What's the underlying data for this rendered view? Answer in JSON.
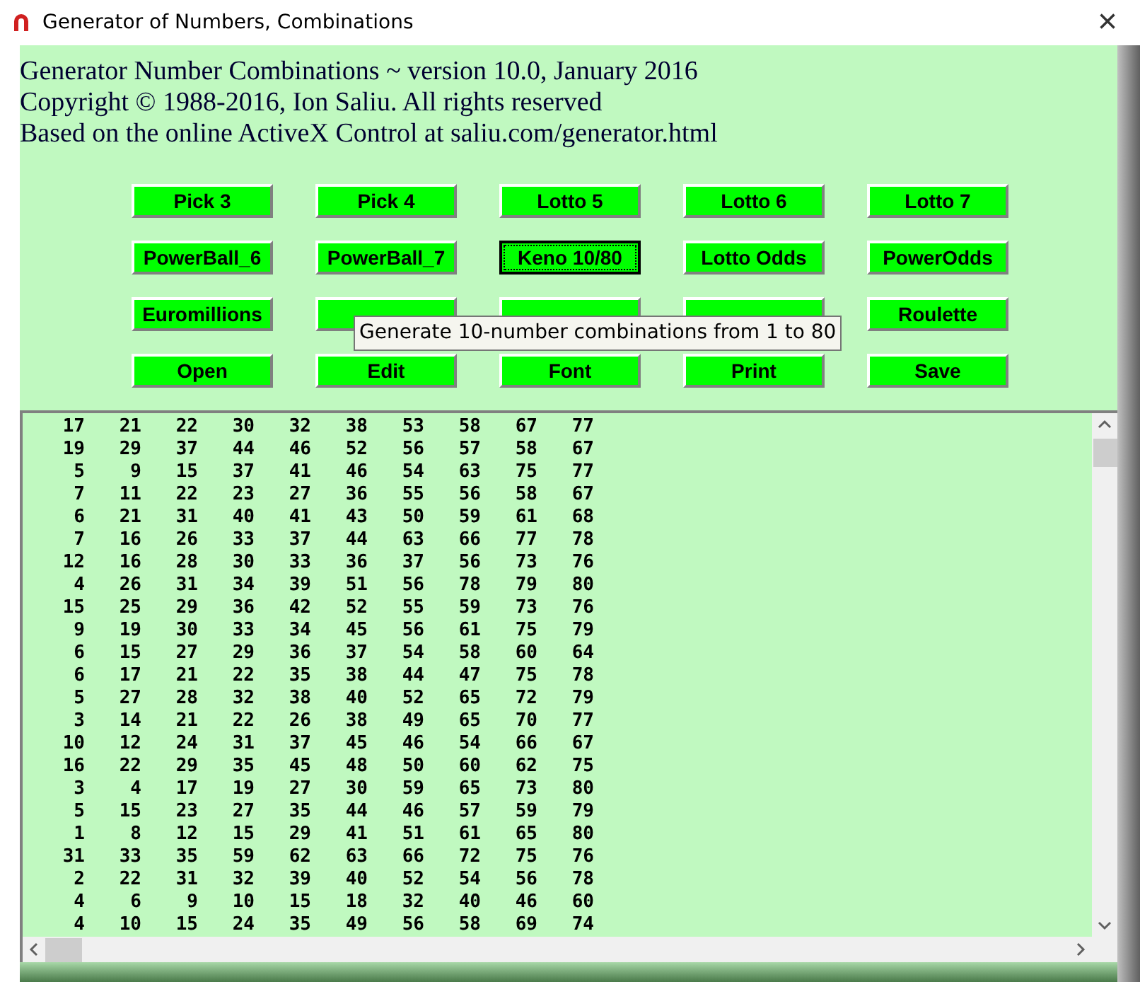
{
  "window": {
    "title": "Generator of Numbers, Combinations",
    "close": "×"
  },
  "header": [
    "Generator Number Combinations ~ version 10.0, January 2016",
    "Copyright © 1988-2016, Ion Saliu. All rights reserved",
    "Based on the online ActiveX Control at saliu.com/generator.html"
  ],
  "buttons": [
    {
      "label": "Pick 3",
      "focused": false
    },
    {
      "label": "Pick 4",
      "focused": false
    },
    {
      "label": "Lotto 5",
      "focused": false
    },
    {
      "label": "Lotto 6",
      "focused": false
    },
    {
      "label": "Lotto 7",
      "focused": false
    },
    {
      "label": "PowerBall_6",
      "focused": false
    },
    {
      "label": "PowerBall_7",
      "focused": false
    },
    {
      "label": "Keno 10/80",
      "focused": true
    },
    {
      "label": "Lotto Odds",
      "focused": false
    },
    {
      "label": "PowerOdds",
      "focused": false
    },
    {
      "label": "Euromillions",
      "focused": false
    },
    {
      "focused": false
    },
    {
      "focused": false
    },
    {
      "focused": false
    },
    {
      "label": "Roulette",
      "focused": false
    },
    {
      "label": "Open",
      "focused": false
    },
    {
      "label": "Edit",
      "focused": false
    },
    {
      "label": "Font",
      "focused": false
    },
    {
      "label": "Print",
      "focused": false
    },
    {
      "label": "Save",
      "focused": false
    }
  ],
  "tooltip": "Generate 10-number combinations from 1 to 80",
  "rows": [
    [
      "17",
      "21",
      "22",
      "30",
      "32",
      "38",
      "53",
      "58",
      "67",
      "77"
    ],
    [
      "19",
      "29",
      "37",
      "44",
      "46",
      "52",
      "56",
      "57",
      "58",
      "67"
    ],
    [
      "5",
      "9",
      "15",
      "37",
      "41",
      "46",
      "54",
      "63",
      "75",
      "77"
    ],
    [
      "7",
      "11",
      "22",
      "23",
      "27",
      "36",
      "55",
      "56",
      "58",
      "67"
    ],
    [
      "6",
      "21",
      "31",
      "40",
      "41",
      "43",
      "50",
      "59",
      "61",
      "68"
    ],
    [
      "7",
      "16",
      "26",
      "33",
      "37",
      "44",
      "63",
      "66",
      "77",
      "78"
    ],
    [
      "12",
      "16",
      "28",
      "30",
      "33",
      "36",
      "37",
      "56",
      "73",
      "76"
    ],
    [
      "4",
      "26",
      "31",
      "34",
      "39",
      "51",
      "56",
      "78",
      "79",
      "80"
    ],
    [
      "15",
      "25",
      "29",
      "36",
      "42",
      "52",
      "55",
      "59",
      "73",
      "76"
    ],
    [
      "9",
      "19",
      "30",
      "33",
      "34",
      "45",
      "56",
      "61",
      "75",
      "79"
    ],
    [
      "6",
      "15",
      "27",
      "29",
      "36",
      "37",
      "54",
      "58",
      "60",
      "64"
    ],
    [
      "6",
      "17",
      "21",
      "22",
      "35",
      "38",
      "44",
      "47",
      "75",
      "78"
    ],
    [
      "5",
      "27",
      "28",
      "32",
      "38",
      "40",
      "52",
      "65",
      "72",
      "79"
    ],
    [
      "3",
      "14",
      "21",
      "22",
      "26",
      "38",
      "49",
      "65",
      "70",
      "77"
    ],
    [
      "10",
      "12",
      "24",
      "31",
      "37",
      "45",
      "46",
      "54",
      "66",
      "67"
    ],
    [
      "16",
      "22",
      "29",
      "35",
      "45",
      "48",
      "50",
      "60",
      "62",
      "75"
    ],
    [
      "3",
      "4",
      "17",
      "19",
      "27",
      "30",
      "59",
      "65",
      "73",
      "80"
    ],
    [
      "5",
      "15",
      "23",
      "27",
      "35",
      "44",
      "46",
      "57",
      "59",
      "79"
    ],
    [
      "1",
      "8",
      "12",
      "15",
      "29",
      "41",
      "51",
      "61",
      "65",
      "80"
    ],
    [
      "31",
      "33",
      "35",
      "59",
      "62",
      "63",
      "66",
      "72",
      "75",
      "76"
    ],
    [
      "2",
      "22",
      "31",
      "32",
      "39",
      "40",
      "52",
      "54",
      "56",
      "78"
    ],
    [
      "4",
      "6",
      "9",
      "10",
      "15",
      "18",
      "32",
      "40",
      "46",
      "60"
    ],
    [
      "4",
      "10",
      "15",
      "24",
      "35",
      "49",
      "56",
      "58",
      "69",
      "74"
    ]
  ]
}
